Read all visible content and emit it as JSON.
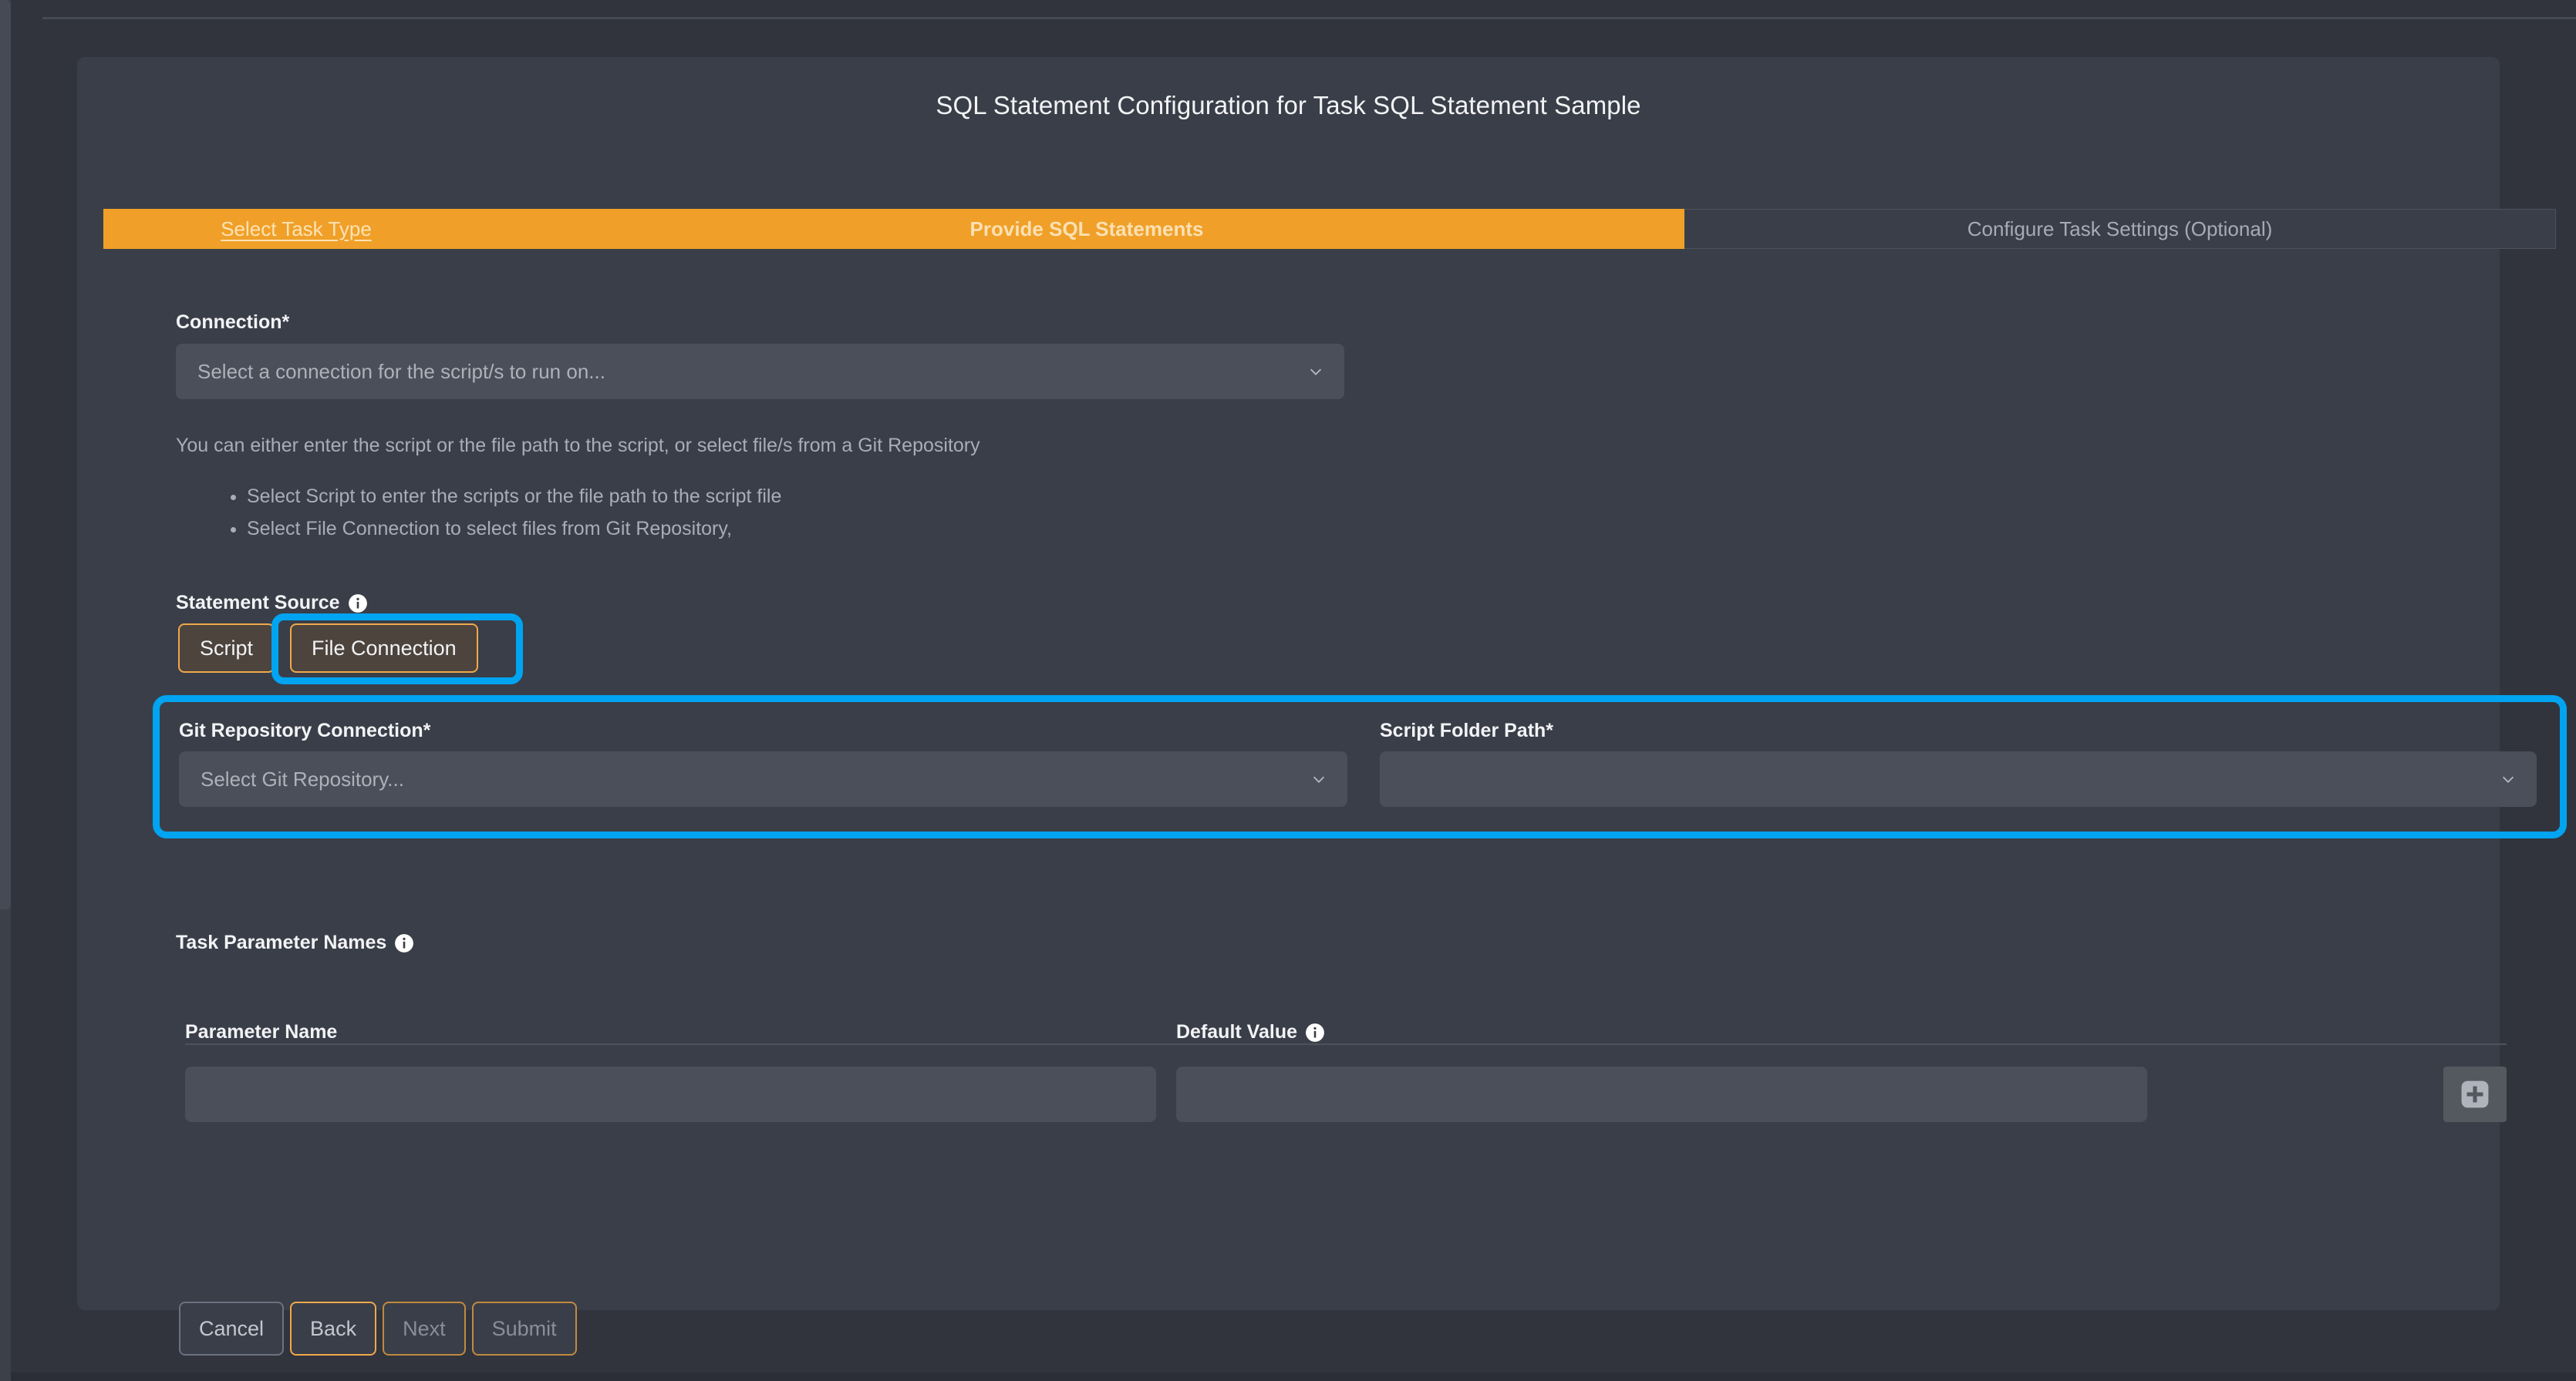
{
  "page": {
    "title": "SQL Statement Configuration for Task SQL Statement Sample"
  },
  "stepper": {
    "steps": [
      {
        "label": "Select Task Type",
        "state": "done"
      },
      {
        "label": "Provide SQL Statements",
        "state": "active"
      },
      {
        "label": "Configure Task Settings (Optional)",
        "state": "todo"
      }
    ]
  },
  "connection": {
    "label": "Connection*",
    "placeholder": "Select a connection for the script/s to run on...",
    "value": ""
  },
  "helper": {
    "intro": "You can either enter the script or the file path to the script, or select file/s from a Git Repository",
    "bullets": [
      "Select Script to enter the scripts or the file path to the script file",
      "Select File Connection to select files from Git Repository,"
    ]
  },
  "statement_source": {
    "label": "Statement Source",
    "info_icon": "info-icon",
    "options": [
      {
        "label": "Script",
        "selected": false
      },
      {
        "label": "File Connection",
        "selected": true
      }
    ]
  },
  "git": {
    "connection_label": "Git Repository Connection*",
    "connection_placeholder": "Select Git Repository...",
    "connection_value": "",
    "folder_label": "Script Folder Path*",
    "folder_placeholder": "",
    "folder_value": ""
  },
  "task_parameters": {
    "label": "Task Parameter Names",
    "info_icon": "info-icon",
    "columns": [
      {
        "label": "Parameter Name",
        "has_info": false
      },
      {
        "label": "Default Value",
        "has_info": true
      }
    ],
    "rows": [
      {
        "parameter_name": "",
        "default_value": ""
      }
    ],
    "add_button_icon": "plus-icon"
  },
  "footer": {
    "buttons": [
      {
        "label": "Cancel",
        "style": "neutral"
      },
      {
        "label": "Back",
        "style": "primary"
      },
      {
        "label": "Next",
        "style": "disabled"
      },
      {
        "label": "Submit",
        "style": "disabled"
      }
    ]
  },
  "colors": {
    "accent_orange": "#f0a028",
    "annotation_blue": "#00a4f0",
    "panel_background": "#3a3e48",
    "page_background": "#31343d",
    "input_background": "#4b4f59"
  }
}
